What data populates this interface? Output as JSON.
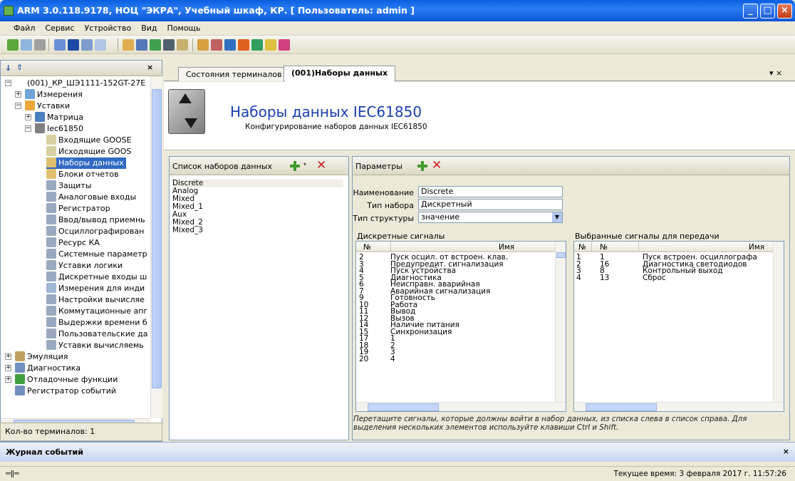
{
  "window": {
    "title": "ARM 3.0.118.9178, НОЦ \"ЭКРА\", Учебный шкаф, КР. [ Пользователь: admin ]",
    "min": "_",
    "max": "□",
    "close": "×"
  },
  "menu": [
    "Файл",
    "Сервис",
    "Устройство",
    "Вид",
    "Помощь"
  ],
  "tree": {
    "root": "(001)_КР_ШЭ1111-152GT-27Е",
    "items": [
      "Измерения",
      "Уставки",
      "Матрица",
      "Iec61850",
      "Входящие GOOSE",
      "Исходящие GOOS",
      "Наборы данных",
      "Блоки отчетов",
      "Защиты",
      "Аналоговые входы",
      "Регистратор",
      "Ввод/вывод приемнь",
      "Осциллографирован",
      "Ресурс КА",
      "Системные параметр",
      "Уставки логики",
      "Дискретные входы ш",
      "Измерения для инди",
      "Настройки вычисляе",
      "Коммутационные апг",
      "Выдержки времени б",
      "Пользовательские да",
      "Уставки вычисляемь",
      "Эмуляция",
      "Диагностика",
      "Отладочные функции",
      "Регистратор событий"
    ],
    "status": "Кол-во терминалов: 1"
  },
  "tabs": [
    "Состояния терминалов",
    "(001)Наборы данных"
  ],
  "header": {
    "title": "Наборы данных IEC61850",
    "subtitle": "Конфигурирование наборов данных IEC61850"
  },
  "datasets": {
    "title": "Список наборов данных",
    "items": [
      "Discrete",
      "Analog",
      "Mixed",
      "Mixed_1",
      "Aux",
      "Mixed_2",
      "Mixed_3"
    ]
  },
  "params": {
    "title": "Параметры",
    "name_label": "Наименование",
    "name_value": "Discrete",
    "type_label": "Тип набора",
    "type_value": "Дискретный",
    "struct_label": "Тип структуры",
    "struct_value": "значение",
    "left_title": "Дискретные сигналы",
    "left_cols": [
      "№",
      "Имя"
    ],
    "left_rows": [
      [
        "2",
        "Пуск осцил. от встроен. клав."
      ],
      [
        "3",
        "Предупредит. сигнализация"
      ],
      [
        "4",
        "Пуск устройства"
      ],
      [
        "5",
        "Диагностика"
      ],
      [
        "6",
        "Неисправн. аварийная"
      ],
      [
        "7",
        "Аварийная сигнализация"
      ],
      [
        "9",
        "Готовность"
      ],
      [
        "10",
        "Работа"
      ],
      [
        "11",
        "Вывод"
      ],
      [
        "12",
        "Вызов"
      ],
      [
        "14",
        "Наличие питания"
      ],
      [
        "15",
        "Синхронизация"
      ],
      [
        "17",
        "1"
      ],
      [
        "18",
        "2"
      ],
      [
        "19",
        "3"
      ],
      [
        "20",
        "4"
      ]
    ],
    "right_title": "Выбранные сигналы для передачи",
    "right_cols": [
      "№",
      "№",
      "Имя"
    ],
    "right_rows": [
      [
        "1",
        "1",
        "Пуск встроен. осциллографа"
      ],
      [
        "2",
        "16",
        "Диагностика светодиодов"
      ],
      [
        "3",
        "8",
        "Контрольный выход"
      ],
      [
        "4",
        "13",
        "Сброс"
      ]
    ],
    "hint": "Перетащите сигналы, которые должны войти в набор данных, из списка слева в список справа. Для выделения нескольких элементов используйте клавиши Ctrl и Shift."
  },
  "journal": "Журнал событий",
  "statusbar": "Текущее время: 3 февраля 2017 г. 11:57:26"
}
